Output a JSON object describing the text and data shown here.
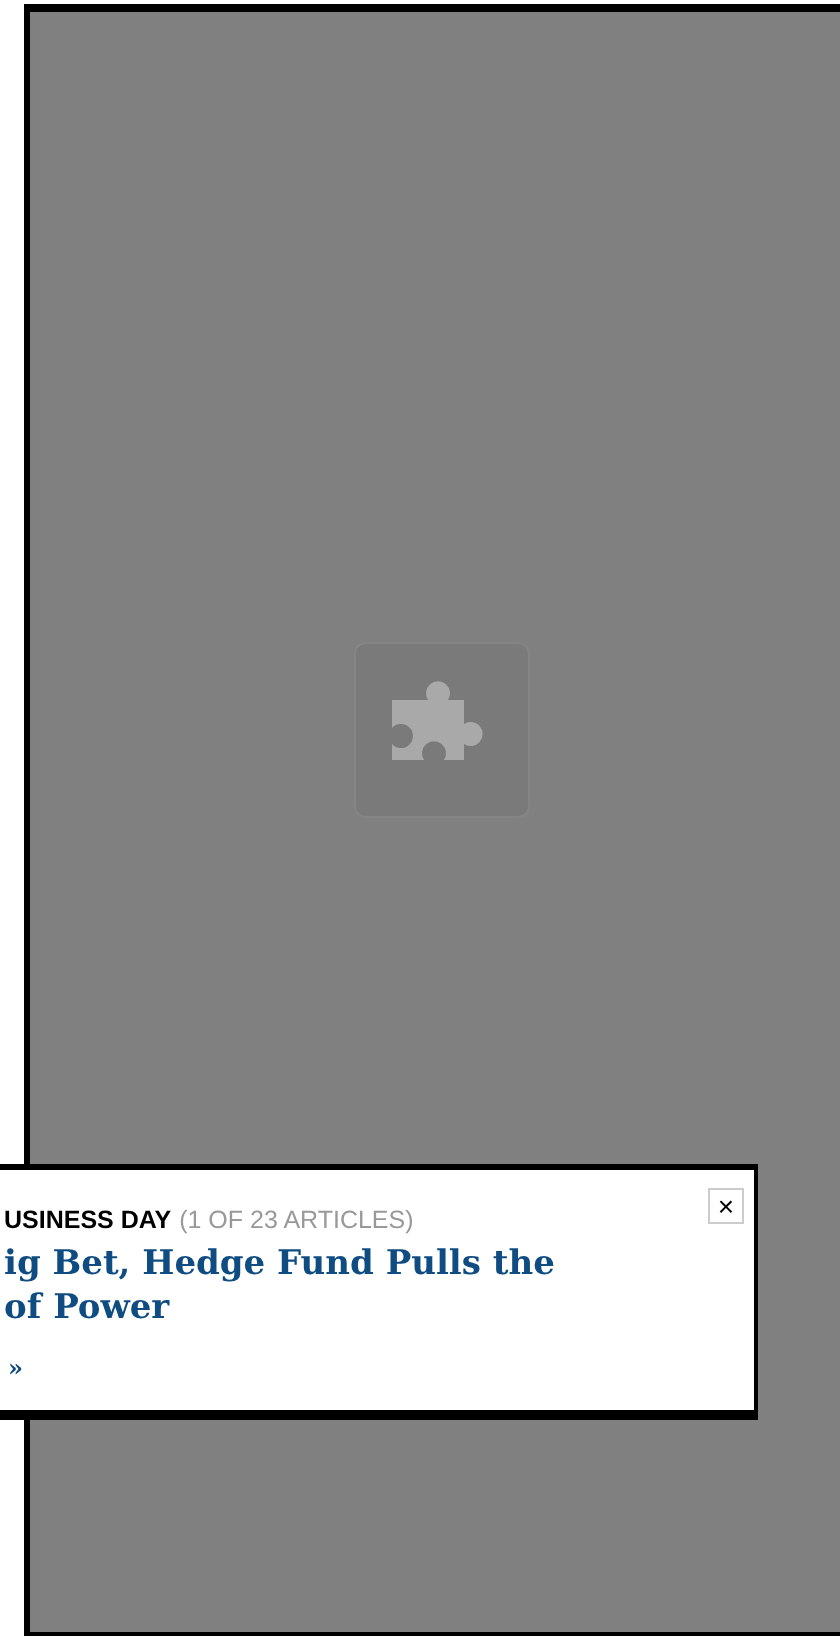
{
  "plugin_placeholder": {
    "kind": "plugin"
  },
  "popup": {
    "section": "USINESS DAY",
    "count": "(1 OF 23 ARTICLES)",
    "headline_lines": [
      "ig Bet, Hedge Fund Pulls the",
      "of Power"
    ],
    "more_link": "»",
    "close": "×"
  }
}
